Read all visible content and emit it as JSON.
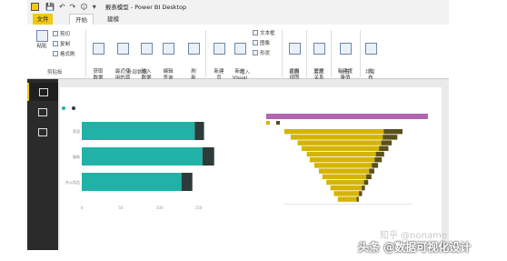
{
  "window": {
    "title": "报表模型 - Power BI Desktop",
    "app_icon": "power-bi-icon",
    "quick_access": [
      "save-icon",
      "undo-icon",
      "redo-icon",
      "smiley-icon",
      "dropdown-icon"
    ]
  },
  "tabs": [
    {
      "label": "文件",
      "active": false
    },
    {
      "label": "开始",
      "active": true
    },
    {
      "label": "建模",
      "active": false
    }
  ],
  "ribbon": {
    "clipboard": {
      "paste": "粘贴",
      "cut": "剪切",
      "copy": "复制",
      "format_painter": "格式刷",
      "group": "剪贴板"
    },
    "external_data": {
      "get_data": "获取\n数据",
      "recent_sources": "最近使\n用的源",
      "enter_data": "输入\n数据",
      "edit_queries": "编辑\n查询",
      "group": "外部数据"
    },
    "refresh": "刷\n新",
    "insert": {
      "new_page": "新建\n页",
      "new_visual": "新的\nVisual",
      "text_box": "文本框",
      "image": "图像",
      "shapes": "形状",
      "group": "插入"
    },
    "view": {
      "page_view": "页面\n视图",
      "group": "视图"
    },
    "relationships": {
      "manage": "管理\n关系",
      "group": "关系"
    },
    "calculations": {
      "new_measure": "新建度\n量值",
      "group": "计算"
    },
    "share": {
      "publish": "发\n布",
      "group": "共享"
    }
  },
  "colors": {
    "accent": "#f2c811",
    "teal": "#20b2a6",
    "dark": "#2e3b3b",
    "gold": "#d4b400",
    "olive": "#5a5018",
    "purple": "#b266b2",
    "nav_bg": "#2b2b2b"
  },
  "chart_data": [
    {
      "type": "bar",
      "orientation": "horizontal",
      "stacked": true,
      "categories": [
        "家居",
        "服装",
        "办公用品"
      ],
      "series": [
        {
          "values": [
            145,
            155,
            128
          ]
        },
        {
          "values": [
            12,
            15,
            14
          ]
        }
      ],
      "xticks": [
        "0",
        "50",
        "100",
        "150"
      ],
      "xlim": [
        0,
        175
      ],
      "legend": "top-left"
    },
    {
      "type": "bar",
      "orientation": "horizontal",
      "subtype": "waterfall-funnel",
      "legend_entries": [
        "",
        ""
      ],
      "categories_count": 13,
      "values": [
        95,
        88,
        80,
        74,
        66,
        62,
        55,
        48,
        42,
        36,
        30,
        24,
        18
      ],
      "secondary": [
        18,
        14,
        10,
        9,
        8,
        7,
        6,
        5,
        5,
        4,
        3,
        3,
        2
      ],
      "legend": "top-left"
    }
  ],
  "watermark": {
    "zhihu": "知乎 @noname",
    "toutiao": "头条 @数据可视化设计"
  }
}
